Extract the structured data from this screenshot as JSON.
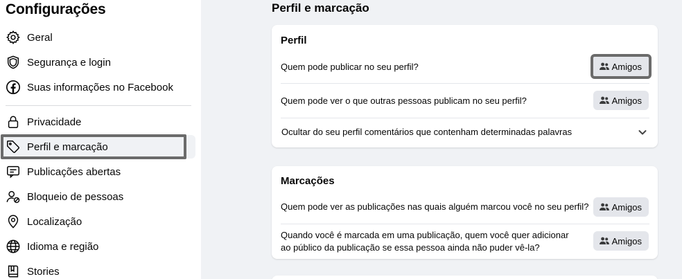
{
  "sidebar": {
    "title": "Configurações",
    "items": [
      {
        "label": "Geral",
        "icon": "gear-icon"
      },
      {
        "label": "Segurança e login",
        "icon": "shield-icon"
      },
      {
        "label": "Suas informações no Facebook",
        "icon": "facebook-icon"
      },
      {
        "label": "Privacidade",
        "icon": "lock-icon"
      },
      {
        "label": "Perfil e marcação",
        "icon": "tag-icon",
        "active": true
      },
      {
        "label": "Publicações abertas",
        "icon": "public-posts-icon"
      },
      {
        "label": "Bloqueio de pessoas",
        "icon": "block-person-icon"
      },
      {
        "label": "Localização",
        "icon": "location-pin-icon"
      },
      {
        "label": "Idioma e região",
        "icon": "globe-icon"
      },
      {
        "label": "Stories",
        "icon": "book-icon"
      }
    ]
  },
  "main": {
    "title": "Perfil e marcação",
    "profile_card": {
      "title": "Perfil",
      "rows": [
        {
          "question": "Quem pode publicar no seu perfil?",
          "value": "Amigos"
        },
        {
          "question": "Quem pode ver o que outras pessoas publicam no seu perfil?",
          "value": "Amigos"
        },
        {
          "question": "Ocultar do seu perfil comentários que contenham determinadas palavras"
        }
      ]
    },
    "tagging_card": {
      "title": "Marcações",
      "rows": [
        {
          "question": "Quem pode ver as publicações nas quais alguém marcou você no seu perfil?",
          "value": "Amigos"
        },
        {
          "question": "Quando você é marcada em uma publicação, quem você quer adicionar ao público da publicação se essa pessoa ainda não puder vê-la?",
          "value": "Amigos"
        }
      ]
    }
  },
  "colors": {
    "highlight_border": "#6b6b6b",
    "button_bg": "#e4e6eb",
    "page_bg": "#f0f2f5"
  }
}
